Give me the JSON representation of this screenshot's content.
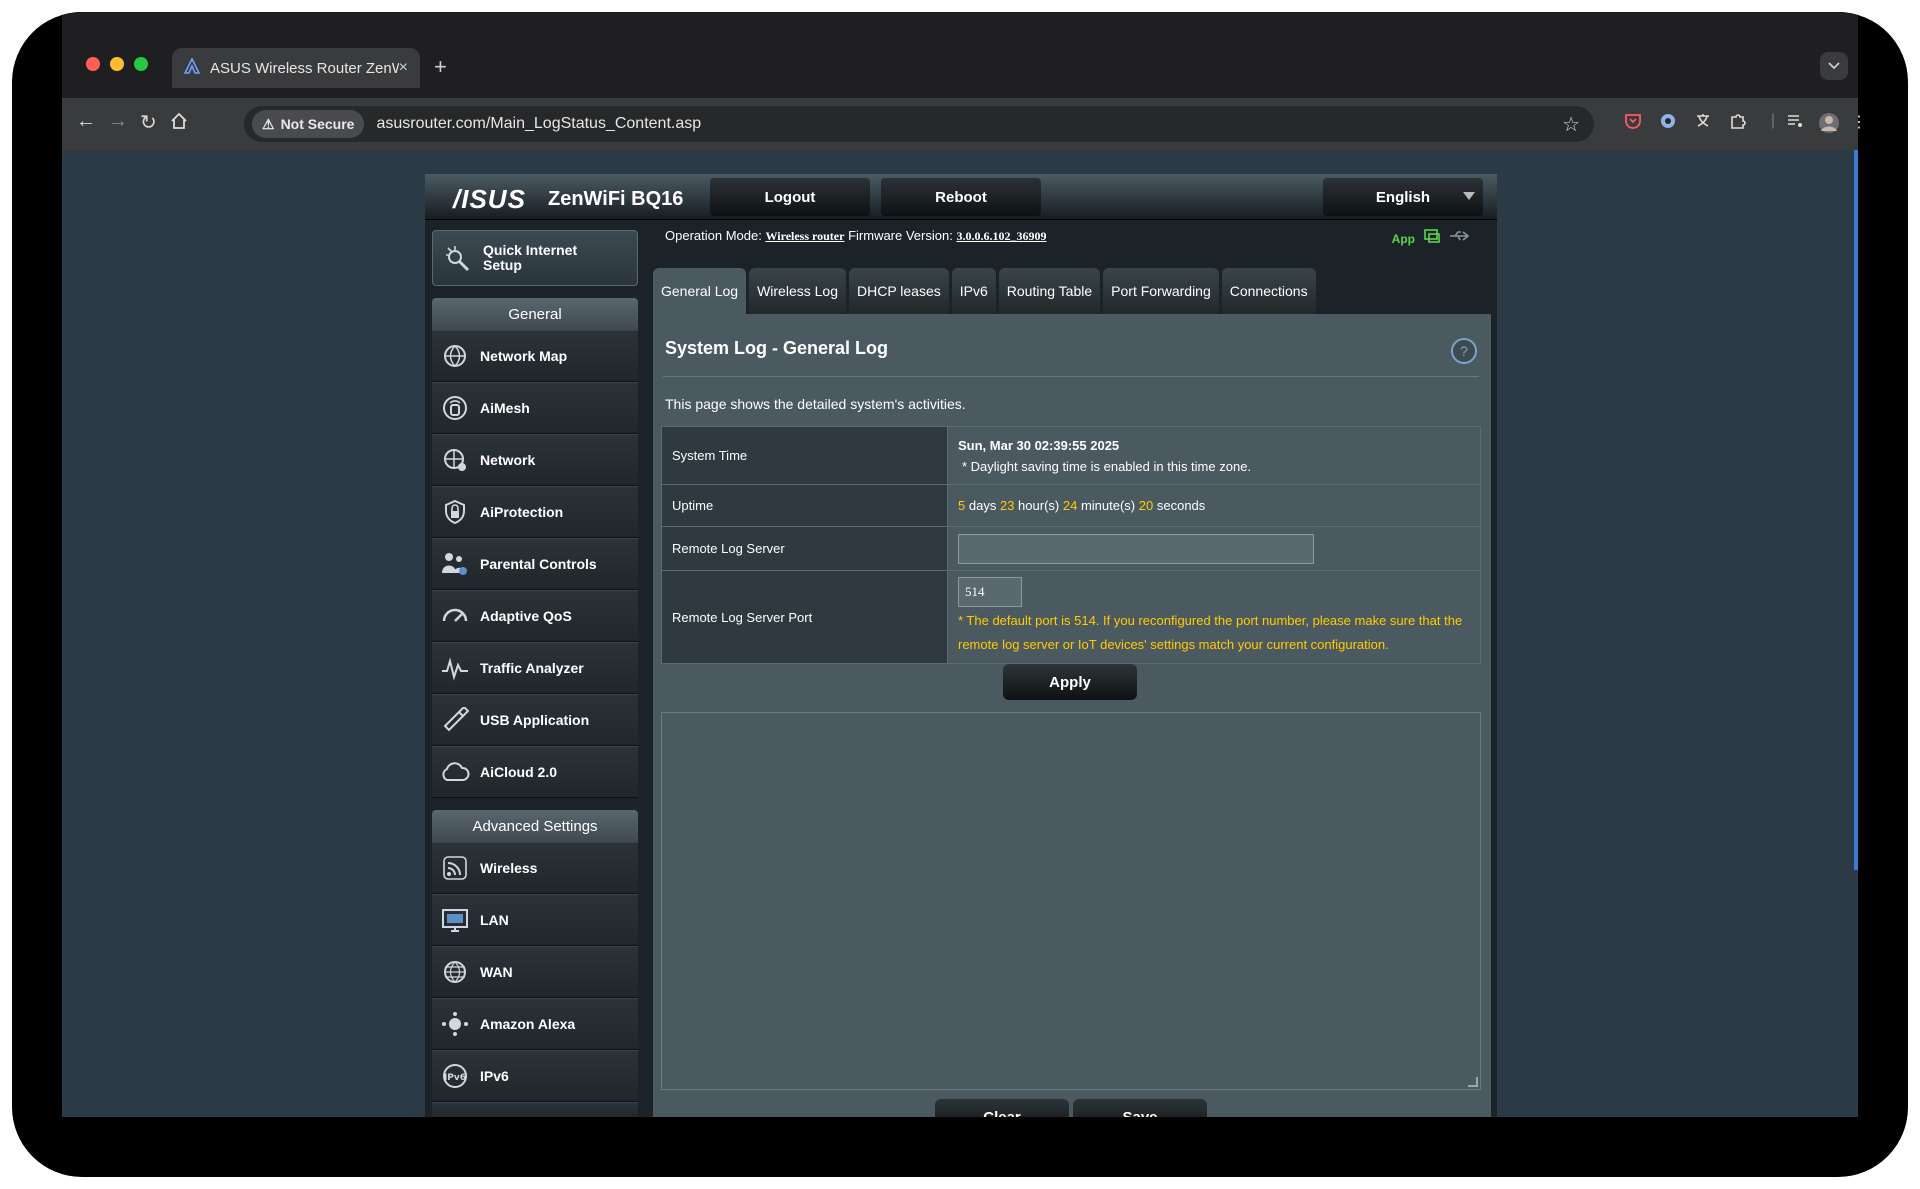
{
  "browser": {
    "tab_title": "ASUS Wireless Router ZenWi",
    "tab_close": "×",
    "new_tab": "+",
    "security_label": "Not Secure",
    "url": "asusrouter.com/Main_LogStatus_Content.asp"
  },
  "router": {
    "logo": "/ISUS",
    "model": "ZenWiFi BQ16",
    "logout_label": "Logout",
    "reboot_label": "Reboot",
    "language": "English",
    "operation_mode_label": "Operation Mode:",
    "operation_mode_value": "Wireless router",
    "firmware_label": "Firmware Version:",
    "firmware_value": "3.0.0.6.102_36909",
    "app_label": "App"
  },
  "sidebar": {
    "quick_setup_label": "Quick Internet Setup",
    "general_header": "General",
    "general_items": [
      {
        "label": "Network Map",
        "icon": "globe-pin-icon"
      },
      {
        "label": "AiMesh",
        "icon": "mesh-router-icon"
      },
      {
        "label": "Network",
        "icon": "network-globe-icon"
      },
      {
        "label": "AiProtection",
        "icon": "shield-lock-icon"
      },
      {
        "label": "Parental Controls",
        "icon": "family-icon"
      },
      {
        "label": "Adaptive QoS",
        "icon": "speedometer-icon"
      },
      {
        "label": "Traffic Analyzer",
        "icon": "pulse-icon"
      },
      {
        "label": "USB Application",
        "icon": "usb-icon"
      },
      {
        "label": "AiCloud 2.0",
        "icon": "cloud-icon"
      }
    ],
    "advanced_header": "Advanced Settings",
    "advanced_items": [
      {
        "label": "Wireless",
        "icon": "wifi-icon"
      },
      {
        "label": "LAN",
        "icon": "monitor-icon"
      },
      {
        "label": "WAN",
        "icon": "globe-icon"
      },
      {
        "label": "Amazon Alexa",
        "icon": "alexa-icon"
      },
      {
        "label": "IPv6",
        "icon": "ipv6-icon"
      }
    ]
  },
  "tabs": [
    "General Log",
    "Wireless Log",
    "DHCP leases",
    "IPv6",
    "Routing Table",
    "Port Forwarding",
    "Connections"
  ],
  "log_page": {
    "title": "System Log - General Log",
    "help": "?",
    "description": "This page shows the detailed system's activities.",
    "system_time_label": "System Time",
    "system_time_value": "Sun, Mar 30 02:39:55 2025",
    "dst_note": "* Daylight saving time is enabled in this time zone.",
    "uptime_label": "Uptime",
    "uptime": {
      "days": "5",
      "days_unit": "days",
      "hours": "23",
      "hours_unit": "hour(s)",
      "minutes": "24",
      "minutes_unit": "minute(s)",
      "seconds": "20",
      "seconds_unit": "seconds"
    },
    "remote_server_label": "Remote Log Server",
    "remote_server_value": "",
    "remote_port_label": "Remote Log Server Port",
    "remote_port_value": "514",
    "port_note": "* The default port is 514. If you reconfigured the port number, please make sure that the remote log server or IoT devices' settings match your current configuration.",
    "apply_label": "Apply",
    "log_content": "",
    "clear_label": "Clear",
    "save_label": "Save"
  },
  "colors": {
    "accent_yellow": "#ffcc00",
    "page_bg": "#2c3a46",
    "panel_bg": "#4b5961",
    "app_green": "#5fd44a"
  }
}
